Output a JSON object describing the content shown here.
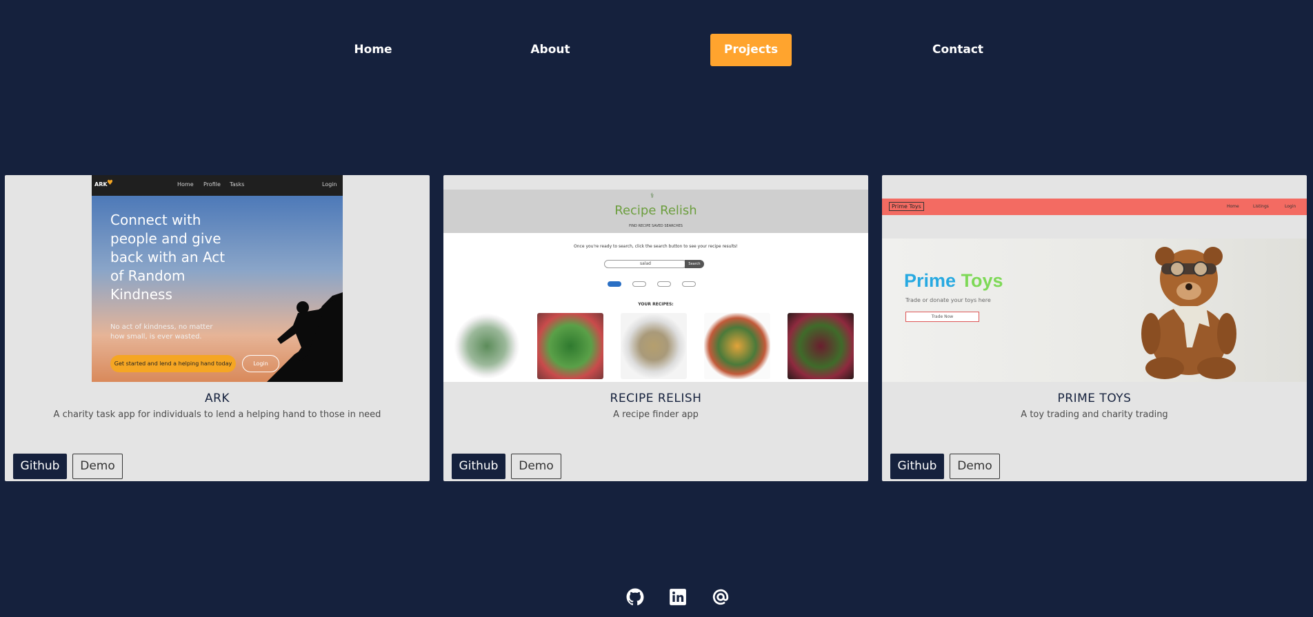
{
  "nav": {
    "items": [
      {
        "label": "Home",
        "active": false
      },
      {
        "label": "About",
        "active": false
      },
      {
        "label": "Projects",
        "active": true
      },
      {
        "label": "Contact",
        "active": false
      }
    ]
  },
  "colors": {
    "background": "#15213d",
    "accent": "#ffa42e",
    "card": "#e4e4e4"
  },
  "projects": [
    {
      "title": "ARK",
      "description": "A charity task app for individuals to lend a helping hand to those in need",
      "github_label": "Github",
      "demo_label": "Demo",
      "screenshot": {
        "brand": "ARK",
        "nav": [
          "Home",
          "Profile",
          "Tasks"
        ],
        "login": "Login",
        "headline": "Connect with people and give back with an Act of Random Kindness",
        "subtext": "No act of kindness, no matter how small, is ever wasted.",
        "cta": "Get started and lend a helping hand today",
        "cta_login": "Login"
      }
    },
    {
      "title": "RECIPE RELISH",
      "description": "A recipe finder app",
      "github_label": "Github",
      "demo_label": "Demo",
      "screenshot": {
        "brand": "Recipe Relish",
        "tabs": "FIND RECIPE     SAVED SEARCHES",
        "prompt": "Once you're ready to search, click the search button to see your recipe results!",
        "search_value": "salad",
        "search_button": "Search",
        "section_label": "YOUR RECIPES:"
      }
    },
    {
      "title": "PRIME TOYS",
      "description": "A toy trading and charity trading",
      "github_label": "Github",
      "demo_label": "Demo",
      "screenshot": {
        "brand": "Prime Toys",
        "nav": [
          "Home",
          "Listings",
          "Login"
        ],
        "headline_part1": "Prime",
        "headline_part2": "Toys",
        "subtext": "Trade or donate your toys here",
        "button": "Trade Now"
      }
    }
  ],
  "footer": {
    "icons": [
      "github-icon",
      "linkedin-icon",
      "email-at-icon"
    ]
  }
}
